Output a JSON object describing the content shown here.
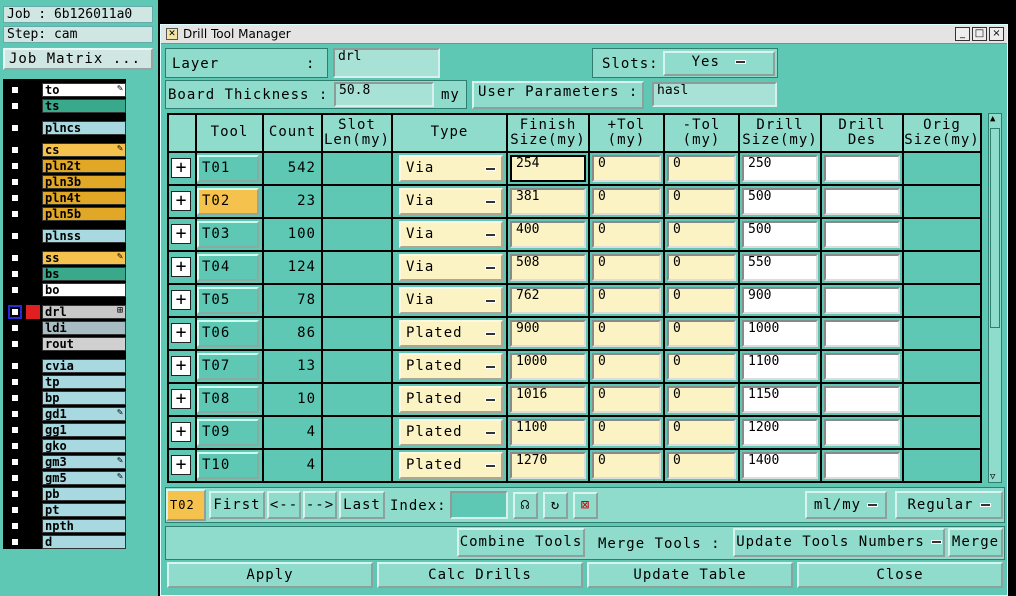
{
  "left": {
    "job_line": "Job : 6b126011a0",
    "step_line": "Step: cam",
    "job_matrix_button": "Job Matrix ..."
  },
  "layers": [
    {
      "name": "to",
      "bg": "#ffffff",
      "flag": "✎"
    },
    {
      "name": "ts",
      "bg": "#3aa88a",
      "flag": ""
    },
    {
      "name": "plncs",
      "bg": "#a8d8e0",
      "flag": ""
    },
    {
      "name": "cs",
      "bg": "#f6c24e",
      "flag": "✎"
    },
    {
      "name": "pln2t",
      "bg": "#e0a826",
      "flag": ""
    },
    {
      "name": "pln3b",
      "bg": "#e0a826",
      "flag": ""
    },
    {
      "name": "pln4t",
      "bg": "#e0a826",
      "flag": ""
    },
    {
      "name": "pln5b",
      "bg": "#e0a826",
      "flag": ""
    },
    {
      "name": "plnss",
      "bg": "#a8d8e0",
      "flag": ""
    },
    {
      "name": "ss",
      "bg": "#f6c24e",
      "flag": "✎"
    },
    {
      "name": "bs",
      "bg": "#3aa88a",
      "flag": ""
    },
    {
      "name": "bo",
      "bg": "#ffffff",
      "flag": ""
    },
    {
      "name": "drl",
      "bg": "#c8c8c8",
      "flag": "⊞"
    },
    {
      "name": "ldi",
      "bg": "#a8bcc4",
      "flag": ""
    },
    {
      "name": "rout",
      "bg": "#d0d0d0",
      "flag": ""
    },
    {
      "name": "cvia",
      "bg": "#a8d8e0",
      "flag": ""
    },
    {
      "name": "tp",
      "bg": "#a8d8e0",
      "flag": ""
    },
    {
      "name": "bp",
      "bg": "#a8d8e0",
      "flag": ""
    },
    {
      "name": "gd1",
      "bg": "#a8d8e0",
      "flag": "✎"
    },
    {
      "name": "gg1",
      "bg": "#a8d8e0",
      "flag": ""
    },
    {
      "name": "gko",
      "bg": "#a8d8e0",
      "flag": ""
    },
    {
      "name": "gm3",
      "bg": "#a8d8e0",
      "flag": "✎"
    },
    {
      "name": "gm5",
      "bg": "#a8d8e0",
      "flag": "✎"
    },
    {
      "name": "pb",
      "bg": "#a8d8e0",
      "flag": ""
    },
    {
      "name": "pt",
      "bg": "#a8d8e0",
      "flag": ""
    },
    {
      "name": "npth",
      "bg": "#a8d8e0",
      "flag": ""
    },
    {
      "name": "d",
      "bg": "#a8d8e0",
      "flag": ""
    }
  ],
  "dialog": {
    "title": "Drill Tool Manager",
    "window_buttons": [
      "_",
      "□",
      "×"
    ],
    "layer_label": "Layer",
    "layer_colon": ":",
    "layer_value": "drl",
    "slots_label": "Slots:",
    "slots_value": "Yes",
    "board_thickness_label": "Board Thickness :",
    "board_thickness_value": "50.8",
    "board_thickness_unit": "my",
    "user_params_label": "User Parameters :",
    "user_params_value": "hasl"
  },
  "table": {
    "headers": [
      "Tool",
      "Count",
      "Slot\nLen(my)",
      "Type",
      "Finish\nSize(my)",
      "+Tol\n(my)",
      "-Tol\n(my)",
      "Drill\nSize(my)",
      "Drill\nDes",
      "Orig\nSize(my)"
    ],
    "rows": [
      {
        "tool": "T01",
        "count": "542",
        "type": "Via",
        "finish": "254",
        "ptol": "0",
        "mtol": "0",
        "drill": "250",
        "des": "",
        "selected": false
      },
      {
        "tool": "T02",
        "count": "23",
        "type": "Via",
        "finish": "381",
        "ptol": "0",
        "mtol": "0",
        "drill": "500",
        "des": "",
        "selected": true
      },
      {
        "tool": "T03",
        "count": "100",
        "type": "Via",
        "finish": "400",
        "ptol": "0",
        "mtol": "0",
        "drill": "500",
        "des": "",
        "selected": false
      },
      {
        "tool": "T04",
        "count": "124",
        "type": "Via",
        "finish": "508",
        "ptol": "0",
        "mtol": "0",
        "drill": "550",
        "des": "",
        "selected": false
      },
      {
        "tool": "T05",
        "count": "78",
        "type": "Via",
        "finish": "762",
        "ptol": "0",
        "mtol": "0",
        "drill": "900",
        "des": "",
        "selected": false
      },
      {
        "tool": "T06",
        "count": "86",
        "type": "Plated",
        "finish": "900",
        "ptol": "0",
        "mtol": "0",
        "drill": "1000",
        "des": "",
        "selected": false
      },
      {
        "tool": "T07",
        "count": "13",
        "type": "Plated",
        "finish": "1000",
        "ptol": "0",
        "mtol": "0",
        "drill": "1100",
        "des": "",
        "selected": false
      },
      {
        "tool": "T08",
        "count": "10",
        "type": "Plated",
        "finish": "1016",
        "ptol": "0",
        "mtol": "0",
        "drill": "1150",
        "des": "",
        "selected": false
      },
      {
        "tool": "T09",
        "count": "4",
        "type": "Plated",
        "finish": "1100",
        "ptol": "0",
        "mtol": "0",
        "drill": "1200",
        "des": "",
        "selected": false
      },
      {
        "tool": "T10",
        "count": "4",
        "type": "Plated",
        "finish": "1270",
        "ptol": "0",
        "mtol": "0",
        "drill": "1400",
        "des": "",
        "selected": false
      }
    ]
  },
  "nav": {
    "current_tool": "T02",
    "first": "First",
    "prev": "<--",
    "next": "-->",
    "last": "Last",
    "index_label": "Index:",
    "index_value": "",
    "units": "ml/my",
    "mode": "Regular"
  },
  "actions": {
    "combine_tools": "Combine Tools",
    "merge_tools_label": "Merge Tools :",
    "update_numbers": "Update Tools Numbers",
    "merge": "Merge"
  },
  "bottom": {
    "apply": "Apply",
    "calc_drills": "Calc Drills",
    "update_table": "Update Table",
    "close": "Close"
  },
  "colors": {
    "panel": "#5ec8b4",
    "selected": "#f6c24e",
    "input_yellow": "#fbf3c4"
  }
}
